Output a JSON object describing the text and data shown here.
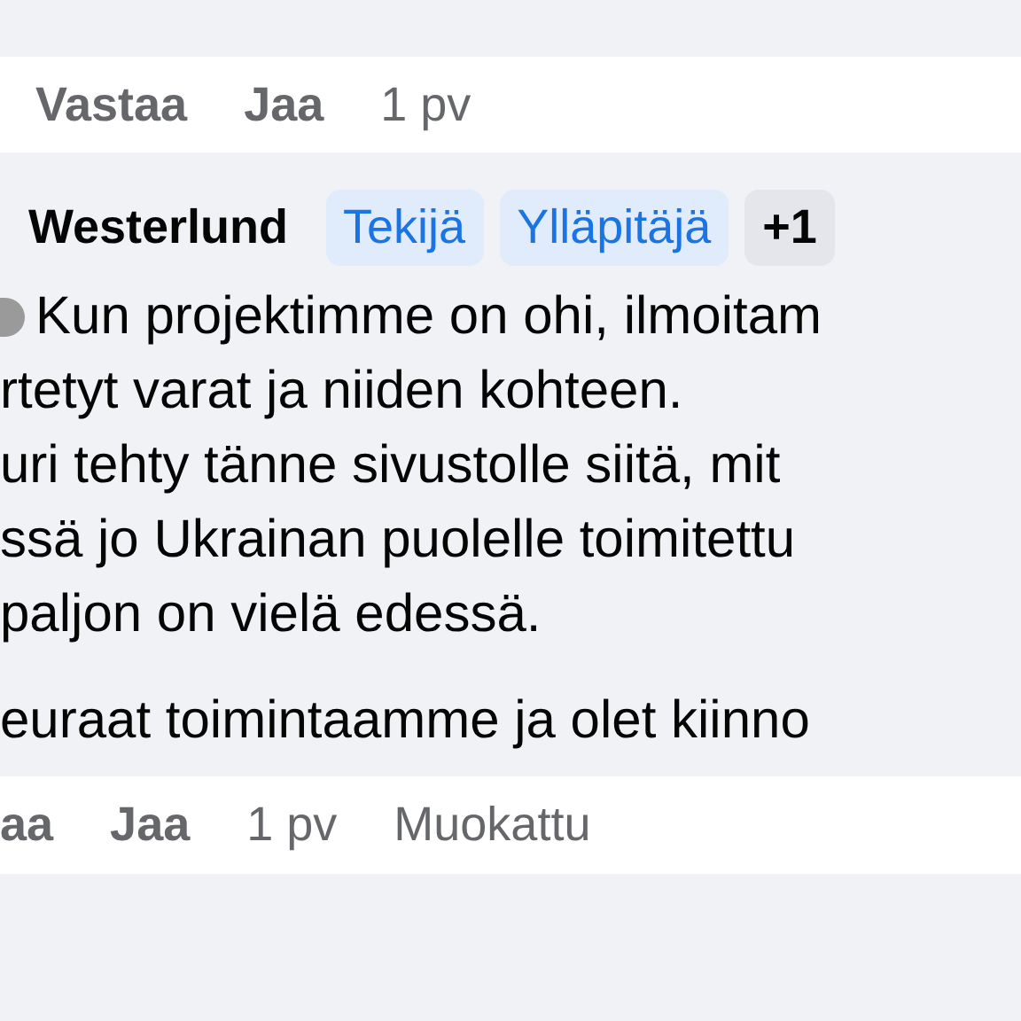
{
  "top_actions": [
    {
      "label": "Vastaa",
      "kind": "link"
    },
    {
      "label": "Jaa",
      "kind": "link"
    },
    {
      "label": "1 pv",
      "kind": "meta"
    }
  ],
  "comment": {
    "author": "Westerlund",
    "badges": [
      {
        "label": "Tekijä",
        "kind": "role"
      },
      {
        "label": "Ylläpitäjä",
        "kind": "role"
      },
      {
        "label": "+1",
        "kind": "more"
      }
    ],
    "lines": [
      {
        "text": "Kun projektimme on ohi, ilmoitam",
        "kind": "emoji-lead"
      },
      {
        "text": "rtetyt varat ja niiden kohteen.",
        "kind": "plain"
      },
      {
        "text": "uri tehty tänne sivustolle siitä, mit",
        "kind": "plain"
      },
      {
        "text": "ssä jo Ukrainan puolelle toimitettu",
        "kind": "plain"
      },
      {
        "text": "paljon on vielä edessä.",
        "kind": "plain"
      },
      {
        "text": "euraat toimintaamme ja olet kiinno",
        "kind": "paragraph"
      }
    ]
  },
  "bottom_actions": [
    {
      "label": "aa",
      "kind": "link"
    },
    {
      "label": "Jaa",
      "kind": "link"
    },
    {
      "label": "1 pv",
      "kind": "meta"
    },
    {
      "label": "Muokattu",
      "kind": "meta"
    }
  ]
}
